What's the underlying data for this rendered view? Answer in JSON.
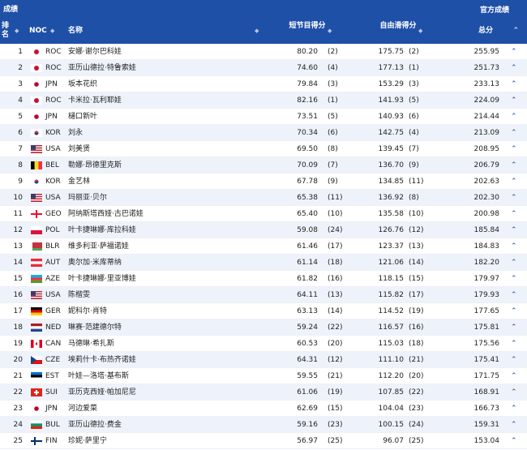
{
  "header": {
    "title": "成绩",
    "official": "官方成绩",
    "rank": "排名",
    "noc": "NOC",
    "name": "名称",
    "short_program": "短节目得分",
    "free_skating": "自由滑得分",
    "total": "总分",
    "expand_icon": "chevron-up-icon"
  },
  "rows": [
    {
      "rank": "1",
      "noc": "ROC",
      "name": "安娜·谢尔巴科娃",
      "sp": "80.20",
      "sp_rank": "(2)",
      "fs": "175.75",
      "fs_rank": "(2)",
      "total": "255.95"
    },
    {
      "rank": "2",
      "noc": "ROC",
      "name": "亚历山德拉·特鲁索娃",
      "sp": "74.60",
      "sp_rank": "(4)",
      "fs": "177.13",
      "fs_rank": "(1)",
      "total": "251.73"
    },
    {
      "rank": "3",
      "noc": "JPN",
      "name": "坂本花织",
      "sp": "79.84",
      "sp_rank": "(3)",
      "fs": "153.29",
      "fs_rank": "(3)",
      "total": "233.13"
    },
    {
      "rank": "4",
      "noc": "ROC",
      "name": "卡米拉·瓦利耶娃",
      "sp": "82.16",
      "sp_rank": "(1)",
      "fs": "141.93",
      "fs_rank": "(5)",
      "total": "224.09"
    },
    {
      "rank": "5",
      "noc": "JPN",
      "name": "樋口新叶",
      "sp": "73.51",
      "sp_rank": "(5)",
      "fs": "140.93",
      "fs_rank": "(6)",
      "total": "214.44"
    },
    {
      "rank": "6",
      "noc": "KOR",
      "name": "刘永",
      "sp": "70.34",
      "sp_rank": "(6)",
      "fs": "142.75",
      "fs_rank": "(4)",
      "total": "213.09"
    },
    {
      "rank": "7",
      "noc": "USA",
      "name": "刘美贤",
      "sp": "69.50",
      "sp_rank": "(8)",
      "fs": "139.45",
      "fs_rank": "(7)",
      "total": "208.95"
    },
    {
      "rank": "8",
      "noc": "BEL",
      "name": "勒娜·昂德里克斯",
      "sp": "70.09",
      "sp_rank": "(7)",
      "fs": "136.70",
      "fs_rank": "(9)",
      "total": "206.79"
    },
    {
      "rank": "9",
      "noc": "KOR",
      "name": "金艺林",
      "sp": "67.78",
      "sp_rank": "(9)",
      "fs": "134.85",
      "fs_rank": "(11)",
      "total": "202.63"
    },
    {
      "rank": "10",
      "noc": "USA",
      "name": "玛丽亚·贝尔",
      "sp": "65.38",
      "sp_rank": "(11)",
      "fs": "136.92",
      "fs_rank": "(8)",
      "total": "202.30"
    },
    {
      "rank": "11",
      "noc": "GEO",
      "name": "阿纳斯塔西娅·古巴诺娃",
      "sp": "65.40",
      "sp_rank": "(10)",
      "fs": "135.58",
      "fs_rank": "(10)",
      "total": "200.98"
    },
    {
      "rank": "12",
      "noc": "POL",
      "name": "叶卡捷琳娜·库拉科娃",
      "sp": "59.08",
      "sp_rank": "(24)",
      "fs": "126.76",
      "fs_rank": "(12)",
      "total": "185.84"
    },
    {
      "rank": "13",
      "noc": "BLR",
      "name": "维多利亚·萨福诺娃",
      "sp": "61.46",
      "sp_rank": "(17)",
      "fs": "123.37",
      "fs_rank": "(13)",
      "total": "184.83"
    },
    {
      "rank": "14",
      "noc": "AUT",
      "name": "奥尔加·米库蒂纳",
      "sp": "61.14",
      "sp_rank": "(18)",
      "fs": "121.06",
      "fs_rank": "(14)",
      "total": "182.20"
    },
    {
      "rank": "15",
      "noc": "AZE",
      "name": "叶卡捷琳娜·里亚博娃",
      "sp": "61.82",
      "sp_rank": "(16)",
      "fs": "118.15",
      "fs_rank": "(15)",
      "total": "179.97"
    },
    {
      "rank": "16",
      "noc": "USA",
      "name": "陈楷雯",
      "sp": "64.11",
      "sp_rank": "(13)",
      "fs": "115.82",
      "fs_rank": "(17)",
      "total": "179.93"
    },
    {
      "rank": "17",
      "noc": "GER",
      "name": "妮科尔·肖特",
      "sp": "63.13",
      "sp_rank": "(14)",
      "fs": "114.52",
      "fs_rank": "(19)",
      "total": "177.65"
    },
    {
      "rank": "18",
      "noc": "NED",
      "name": "琳赛·范建德尔特",
      "sp": "59.24",
      "sp_rank": "(22)",
      "fs": "116.57",
      "fs_rank": "(16)",
      "total": "175.81"
    },
    {
      "rank": "19",
      "noc": "CAN",
      "name": "马德琳·希扎斯",
      "sp": "60.53",
      "sp_rank": "(20)",
      "fs": "115.03",
      "fs_rank": "(18)",
      "total": "175.56"
    },
    {
      "rank": "20",
      "noc": "CZE",
      "name": "埃莉什卡·布热齐诺娃",
      "sp": "64.31",
      "sp_rank": "(12)",
      "fs": "111.10",
      "fs_rank": "(21)",
      "total": "175.41"
    },
    {
      "rank": "21",
      "noc": "EST",
      "name": "叶娃—洛塔·基布斯",
      "sp": "59.55",
      "sp_rank": "(21)",
      "fs": "112.20",
      "fs_rank": "(20)",
      "total": "171.75"
    },
    {
      "rank": "22",
      "noc": "SUI",
      "name": "亚历克西娅·帕加尼尼",
      "sp": "61.06",
      "sp_rank": "(19)",
      "fs": "107.85",
      "fs_rank": "(22)",
      "total": "168.91"
    },
    {
      "rank": "23",
      "noc": "JPN",
      "name": "河边爱菜",
      "sp": "62.69",
      "sp_rank": "(15)",
      "fs": "104.04",
      "fs_rank": "(23)",
      "total": "166.73"
    },
    {
      "rank": "24",
      "noc": "BUL",
      "name": "亚历山德拉·费金",
      "sp": "59.16",
      "sp_rank": "(23)",
      "fs": "100.15",
      "fs_rank": "(24)",
      "total": "159.31"
    },
    {
      "rank": "25",
      "noc": "FIN",
      "name": "珍妮·萨里宁",
      "sp": "56.97",
      "sp_rank": "(25)",
      "fs": "96.07",
      "fs_rank": "(25)",
      "total": "153.04"
    }
  ]
}
